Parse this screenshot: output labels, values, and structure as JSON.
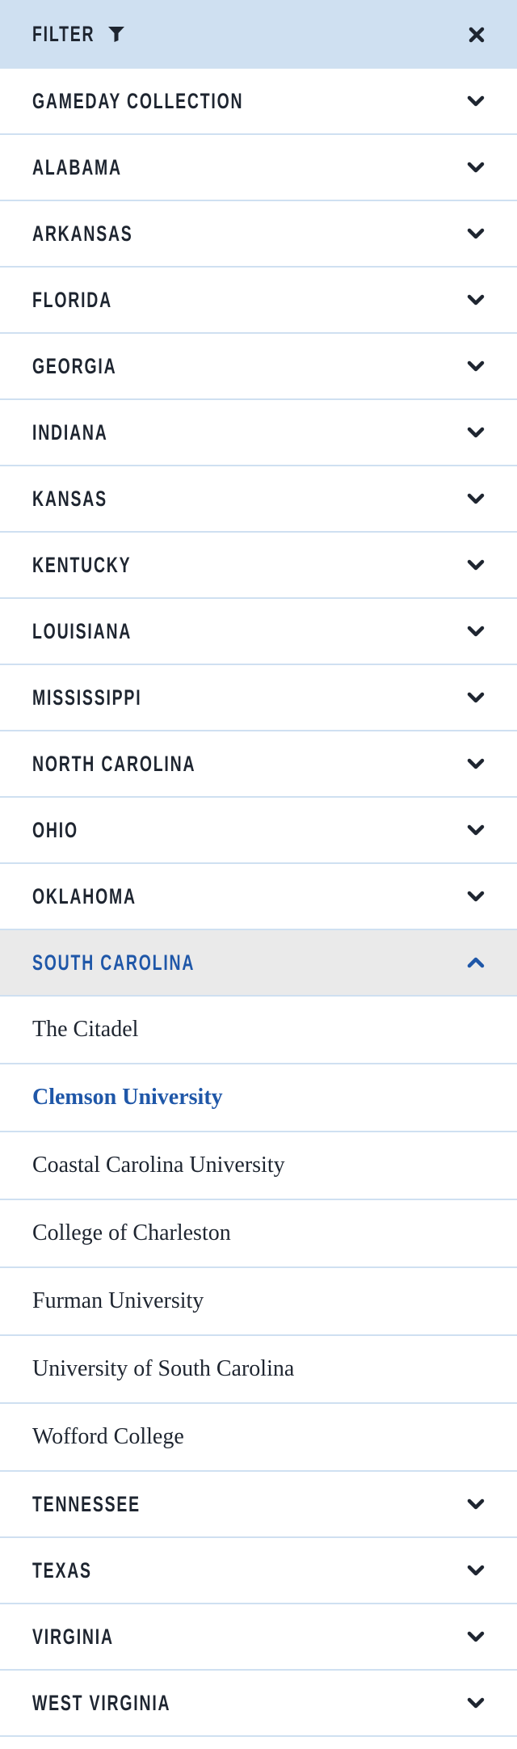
{
  "header": {
    "title": "FILTER",
    "filter_icon": "funnel-icon",
    "close_icon": "close-icon"
  },
  "colors": {
    "text": "#1e2530",
    "accent": "#1f57a8",
    "header_bg": "#cfe0f1",
    "expanded_bg": "#eaeaea",
    "divider": "#cfe0f1"
  },
  "groups_before": [
    {
      "label": "GAMEDAY COLLECTION"
    },
    {
      "label": "ALABAMA"
    },
    {
      "label": "ARKANSAS"
    },
    {
      "label": "FLORIDA"
    },
    {
      "label": "GEORGIA"
    },
    {
      "label": "INDIANA"
    },
    {
      "label": "KANSAS"
    },
    {
      "label": "KENTUCKY"
    },
    {
      "label": "LOUISIANA"
    },
    {
      "label": "MISSISSIPPI"
    },
    {
      "label": "NORTH CAROLINA"
    },
    {
      "label": "OHIO"
    },
    {
      "label": "OKLAHOMA"
    }
  ],
  "expanded_group": {
    "label": "SOUTH CAROLINA",
    "expanded": true,
    "items": [
      {
        "label": "The Citadel",
        "selected": false
      },
      {
        "label": "Clemson University",
        "selected": true
      },
      {
        "label": "Coastal Carolina University",
        "selected": false
      },
      {
        "label": "College of Charleston",
        "selected": false
      },
      {
        "label": "Furman University",
        "selected": false
      },
      {
        "label": "University of South Carolina",
        "selected": false
      },
      {
        "label": "Wofford College",
        "selected": false
      }
    ]
  },
  "groups_after": [
    {
      "label": "TENNESSEE"
    },
    {
      "label": "TEXAS"
    },
    {
      "label": "VIRGINIA"
    },
    {
      "label": "WEST VIRGINIA"
    }
  ]
}
